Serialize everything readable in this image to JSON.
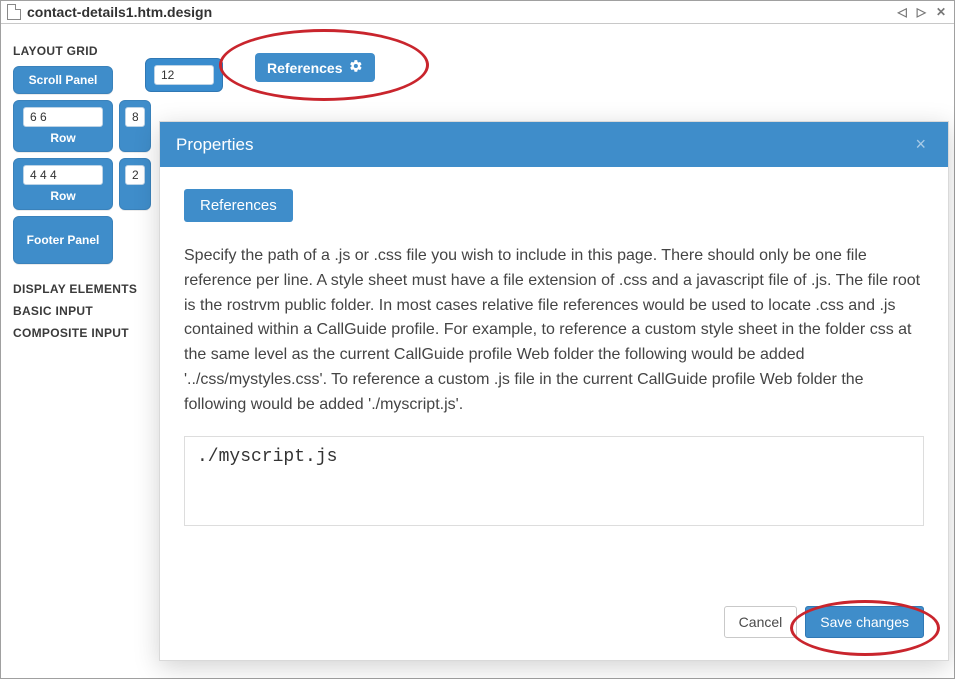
{
  "titlebar": {
    "title": "contact-details1.htm.design",
    "nav_prev": "◁",
    "nav_next": "▷",
    "close": "✕"
  },
  "sidebar": {
    "layout_header": "LAYOUT GRID",
    "display_header": "DISPLAY ELEMENTS",
    "basic_input_header": "BASIC INPUT",
    "composite_input_header": "COMPOSITE INPUT",
    "scroll_panel_label": "Scroll Panel",
    "row_label": "Row",
    "footer_panel_label": "Footer Panel",
    "row1_value": "6 6",
    "row2_value": "4 4 4",
    "row3_value": "8",
    "row4_value": "2"
  },
  "canvas": {
    "col_value": "12",
    "references_label": "References"
  },
  "modal": {
    "title": "Properties",
    "tab_label": "References",
    "help_text": "Specify the path of a .js or .css file you wish to include in this page. There should only be one file reference per line. A style sheet must have a file extension of .css and a javascript file of .js. The file root is the rostrvm public folder. In most cases relative file references would be used to locate .css and .js contained within a CallGuide profile. For example, to reference a custom style sheet in the folder css at the same level as the current CallGuide profile Web folder the following would be added '../css/mystyles.css'. To reference a custom .js file in the current CallGuide profile Web folder the following would be added './myscript.js'.",
    "textarea_value": "./myscript.js",
    "cancel_label": "Cancel",
    "save_label": "Save changes"
  }
}
